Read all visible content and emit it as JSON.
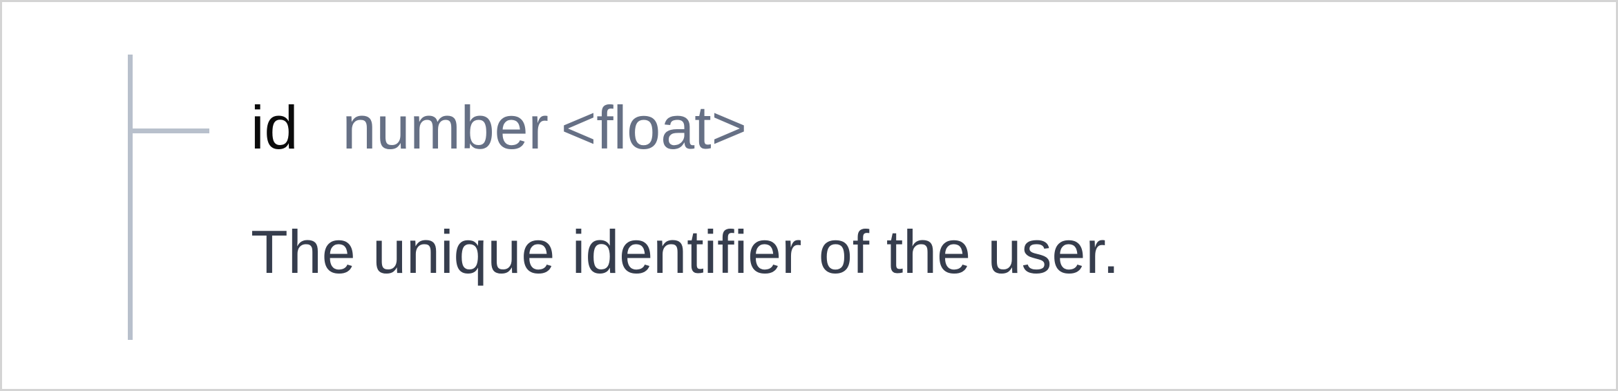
{
  "field": {
    "name": "id",
    "type": "number",
    "format": "<float>",
    "description": "The unique identifier of the user."
  }
}
